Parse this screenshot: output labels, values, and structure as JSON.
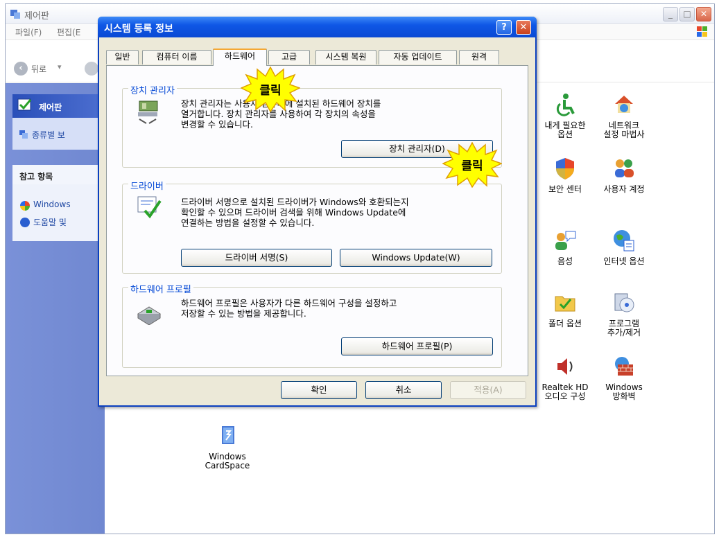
{
  "window": {
    "title": "제어판",
    "menu": [
      "파일(F)",
      "편집(E"
    ],
    "back_label": "뒤로"
  },
  "left_pane": {
    "cp_title": "제어판",
    "cp_link": "종류별 보",
    "ref_title": "참고 항목",
    "ref_items": [
      "Windows",
      "도움말 및"
    ]
  },
  "icons": [
    {
      "name": "accessibility",
      "label": "내게 필요한\n옵션"
    },
    {
      "name": "network-wizard",
      "label": "네트워크\n설정 마법사"
    },
    {
      "name": "security-center",
      "label": "보안 센터"
    },
    {
      "name": "user-accounts",
      "label": "사용자 계정"
    },
    {
      "name": "speech",
      "label": "음성"
    },
    {
      "name": "internet-options",
      "label": "인터넷 옵션"
    },
    {
      "name": "folder-options",
      "label": "폴더 옵션"
    },
    {
      "name": "add-remove-programs",
      "label": "프로그램\n추가/제거"
    },
    {
      "name": "realtek-audio",
      "label": "Realtek HD\n오디오 구성"
    },
    {
      "name": "windows-firewall",
      "label": "Windows\n방화벽"
    },
    {
      "name": "cardspace",
      "label": "Windows\nCardSpace"
    }
  ],
  "dialog": {
    "title": "시스템 등록 정보",
    "help": "?",
    "close": "✕",
    "tabs": [
      "일반",
      "컴퓨터 이름",
      "하드웨어",
      "고급",
      "시스템 복원",
      "자동 업데이트",
      "원격"
    ],
    "groups": {
      "device_manager": {
        "title": "장치 관리자",
        "text": [
          "장치 관리자는 사용자 컴퓨터에 설치된 하드웨어 장치를",
          "열거합니다. 장치 관리자를 사용하여 각 장치의 속성을",
          "변경할 수 있습니다."
        ],
        "button": "장치 관리자(D)"
      },
      "drivers": {
        "title": "드라이버",
        "text": [
          "드라이버 서명으로 설치된 드라이버가 Windows와 호환되는지",
          "확인할 수 있으며 드라이버 검색을 위해 Windows Update에",
          "연결하는 방법을 설정할 수 있습니다."
        ],
        "button_sign": "드라이버 서명(S)",
        "button_update": "Windows Update(W)"
      },
      "profiles": {
        "title": "하드웨어 프로필",
        "text": [
          "하드웨어 프로필은 사용자가 다른 하드웨어 구성을 설정하고",
          "저장할 수 있는 방법을 제공합니다."
        ],
        "button": "하드웨어 프로필(P)"
      }
    },
    "ok": "확인",
    "cancel": "취소",
    "apply": "적용(A)"
  },
  "callouts": [
    "클릭",
    "클릭"
  ],
  "colors": {
    "callout_fill": "#ffff00",
    "callout_stroke": "#e0a000",
    "title_blue": "#0a49d4",
    "group_title": "#0046d5"
  }
}
